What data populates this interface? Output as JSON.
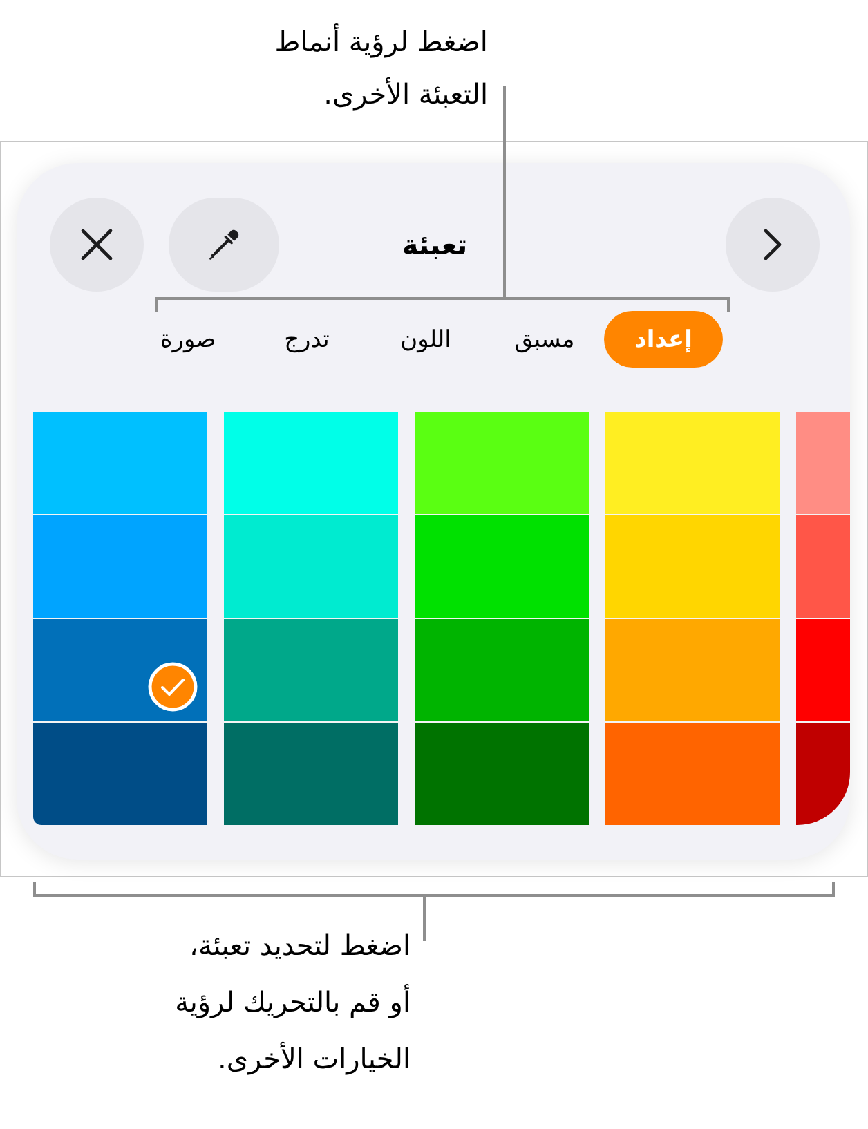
{
  "top_callout": {
    "lines": [
      "اضغط لرؤية أنماط",
      "التعبئة الأخرى."
    ]
  },
  "fill_panel": {
    "title": "تعبئة",
    "buttons": [
      {
        "kind": "close"
      },
      {
        "kind": "eyedropper"
      },
      {
        "kind": "next"
      }
    ],
    "tabs": [
      {
        "label": "إعداد",
        "selected": true
      },
      {
        "label": "مسبق",
        "selected": false
      },
      {
        "label": "اللون",
        "selected": false
      },
      {
        "label": "تدرج",
        "selected": false
      },
      {
        "label": "صورة",
        "selected": false
      }
    ],
    "swatch_columns": [
      {
        "swatches": [
          {
            "color": "#00c0ff",
            "selected": false
          },
          {
            "color": "#00a4ff",
            "selected": false
          },
          {
            "color": "#0170b9",
            "selected": true
          },
          {
            "color": "#004d87",
            "selected": false
          }
        ]
      },
      {
        "swatches": [
          {
            "color": "#00ffe8",
            "selected": false
          },
          {
            "color": "#00ebd0",
            "selected": false
          },
          {
            "color": "#00a88a",
            "selected": false
          },
          {
            "color": "#006e64",
            "selected": false
          }
        ]
      },
      {
        "swatches": [
          {
            "color": "#5aff12",
            "selected": false
          },
          {
            "color": "#00e100",
            "selected": false
          },
          {
            "color": "#00b400",
            "selected": false
          },
          {
            "color": "#007300",
            "selected": false
          }
        ]
      },
      {
        "swatches": [
          {
            "color": "#ffee22",
            "selected": false
          },
          {
            "color": "#ffd600",
            "selected": false
          },
          {
            "color": "#ffa800",
            "selected": false
          },
          {
            "color": "#ff6400",
            "selected": false
          }
        ]
      },
      {
        "swatches": [
          {
            "color": "#ff8d84",
            "selected": false
          },
          {
            "color": "#ff5648",
            "selected": false
          },
          {
            "color": "#ff0000",
            "selected": false
          },
          {
            "color": "#c00000",
            "selected": false
          }
        ]
      }
    ]
  },
  "bottom_callout": {
    "lines": [
      "اضغط لتحديد تعبئة،",
      "أو قم بالتحريك لرؤية",
      "الخيارات الأخرى."
    ]
  }
}
